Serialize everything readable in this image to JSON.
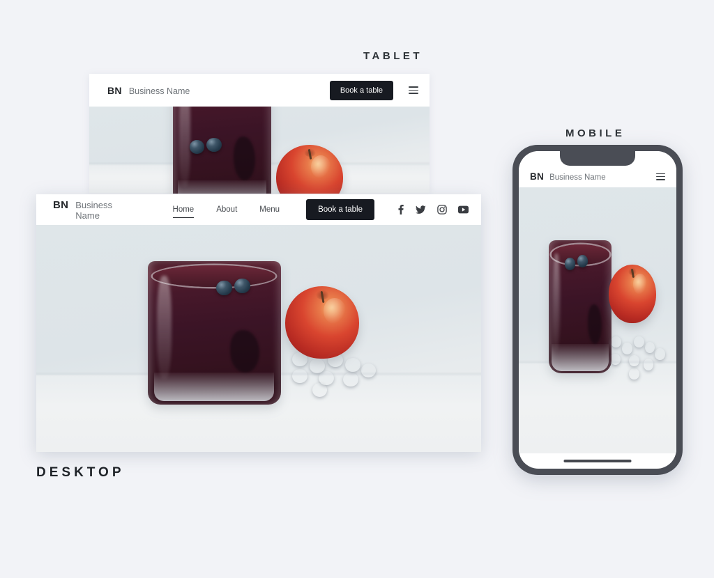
{
  "page": {
    "background_color": "#f2f3f7",
    "accent_dark": "#171a21"
  },
  "labels": {
    "tablet": "TABLET",
    "mobile": "MOBILE",
    "desktop": "DESKTOP"
  },
  "brand": {
    "mark": "BN",
    "name": "Business Name"
  },
  "desktop_mockup": {
    "nav_links": [
      {
        "label": "Home",
        "active": true
      },
      {
        "label": "About",
        "active": false
      },
      {
        "label": "Menu",
        "active": false
      }
    ],
    "cta_label": "Book a table",
    "socials": [
      {
        "name": "facebook-icon"
      },
      {
        "name": "twitter-icon"
      },
      {
        "name": "instagram-icon"
      },
      {
        "name": "youtube-icon"
      }
    ]
  },
  "tablet_mockup": {
    "cta_label": "Book a table",
    "menu_icon": "hamburger-icon"
  },
  "mobile_mockup": {
    "menu_icon": "hamburger-icon"
  },
  "hero_image": {
    "description": "Dark berry smoothie in a glass topped with two blueberries, a red apple and scattered blueberries on a light grey surface",
    "background_color": "#dfe6e9",
    "smoothie_color": "#3b1426",
    "apple_color": "#d9452f",
    "berry_color": "#22384a",
    "top_berry_count": 2,
    "scattered_berry_count": 9
  }
}
